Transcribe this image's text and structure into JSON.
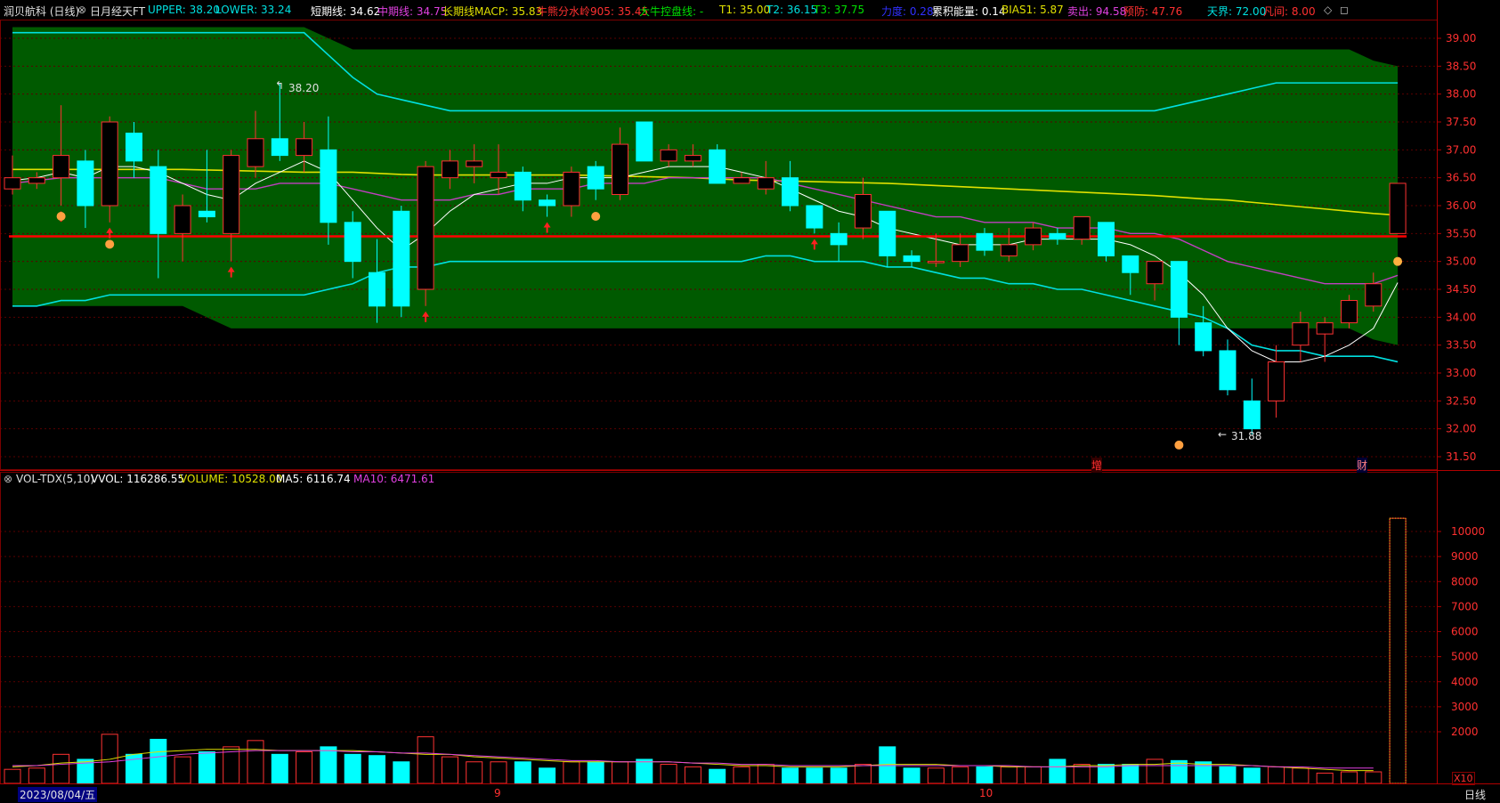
{
  "header": {
    "stock": "润贝航科 (日线)",
    "indicator": "日月经天FT",
    "upper": "UPPER: 38.20",
    "lower": "LOWER: 33.24",
    "short_line": "短期线: 34.62",
    "mid_line": "中期线: 34.75",
    "long_line": "长期线MACP: 35.83",
    "bull_line": "牛熊分水岭905: 35.45",
    "big_bull": "大牛控盘线: -",
    "t1": "T1: 35.00",
    "t2": "T2: 36.15",
    "t3": "T3: 37.75",
    "force": "力度: 0.28",
    "energy": "累积能量: 0.14",
    "bias": "BIAS1: 5.87",
    "sell": "卖出: 94.58",
    "warn": "预防: 47.76",
    "sky": "天界: 72.00",
    "hell": "凡间: 8.00"
  },
  "volume_header": {
    "name": "VOL-TDX(5,10)",
    "vvol": "VVOL: 116286.55",
    "volume": "VOLUME: 10528.00",
    "ma5": "MA5: 6116.74",
    "ma10": "MA10: 6471.61"
  },
  "annotations": {
    "high_label": "38.20",
    "low_label": "31.88",
    "zeng": "增",
    "cai": "财"
  },
  "footer": {
    "date": "2023/08/04/五",
    "month_9": "9",
    "month_10": "10",
    "period": "日线",
    "x10": "X10"
  },
  "colors": {
    "up": "#ff3232",
    "down": "#00ffff",
    "band_fill": "#005a00",
    "ma_short": "#ffffff",
    "ma_mid": "#c040c0",
    "ma_long": "#e0e000",
    "bull_line": "#ff0000",
    "band_line": "#00e0e0"
  },
  "chart_data": [
    {
      "type": "candlestick",
      "title": "润贝航科 (日线)",
      "ylim": [
        31.3,
        39.3
      ],
      "yticks": [
        31.5,
        32.0,
        32.5,
        33.0,
        33.5,
        34.0,
        34.5,
        35.0,
        35.5,
        36.0,
        36.5,
        37.0,
        37.5,
        38.0,
        38.5,
        39.0
      ],
      "candles": [
        {
          "o": 36.3,
          "c": 36.5,
          "h": 36.9,
          "l": 36.2
        },
        {
          "o": 36.4,
          "c": 36.5,
          "h": 36.6,
          "l": 36.3
        },
        {
          "o": 36.5,
          "c": 36.9,
          "h": 37.8,
          "l": 36.0
        },
        {
          "o": 36.8,
          "c": 36.0,
          "h": 37.0,
          "l": 35.6
        },
        {
          "o": 36.0,
          "c": 37.5,
          "h": 37.6,
          "l": 35.7
        },
        {
          "o": 37.3,
          "c": 36.8,
          "h": 37.5,
          "l": 36.5
        },
        {
          "o": 36.7,
          "c": 35.5,
          "h": 37.0,
          "l": 34.7
        },
        {
          "o": 35.5,
          "c": 36.0,
          "h": 36.2,
          "l": 35.0
        },
        {
          "o": 35.9,
          "c": 35.8,
          "h": 37.0,
          "l": 35.7
        },
        {
          "o": 35.5,
          "c": 36.9,
          "h": 37.0,
          "l": 35.0
        },
        {
          "o": 36.7,
          "c": 37.2,
          "h": 37.7,
          "l": 36.5
        },
        {
          "o": 37.2,
          "c": 36.9,
          "h": 38.2,
          "l": 36.8
        },
        {
          "o": 36.9,
          "c": 37.2,
          "h": 37.5,
          "l": 36.6
        },
        {
          "o": 37.0,
          "c": 35.7,
          "h": 37.6,
          "l": 35.3
        },
        {
          "o": 35.7,
          "c": 35.0,
          "h": 35.9,
          "l": 34.7
        },
        {
          "o": 34.8,
          "c": 34.2,
          "h": 35.4,
          "l": 33.9
        },
        {
          "o": 35.9,
          "c": 34.2,
          "h": 36.0,
          "l": 34.0
        },
        {
          "o": 34.5,
          "c": 36.7,
          "h": 36.8,
          "l": 34.2
        },
        {
          "o": 36.5,
          "c": 36.8,
          "h": 37.0,
          "l": 36.3
        },
        {
          "o": 36.7,
          "c": 36.8,
          "h": 37.1,
          "l": 36.4
        },
        {
          "o": 36.5,
          "c": 36.6,
          "h": 37.1,
          "l": 36.2
        },
        {
          "o": 36.6,
          "c": 36.1,
          "h": 36.7,
          "l": 35.9
        },
        {
          "o": 36.1,
          "c": 36.0,
          "h": 36.2,
          "l": 35.8
        },
        {
          "o": 36.0,
          "c": 36.6,
          "h": 36.7,
          "l": 35.8
        },
        {
          "o": 36.7,
          "c": 36.3,
          "h": 36.8,
          "l": 36.1
        },
        {
          "o": 36.2,
          "c": 37.1,
          "h": 37.4,
          "l": 36.1
        },
        {
          "o": 37.5,
          "c": 36.8,
          "h": 37.5,
          "l": 36.8
        },
        {
          "o": 36.8,
          "c": 37.0,
          "h": 37.1,
          "l": 36.7
        },
        {
          "o": 36.8,
          "c": 36.9,
          "h": 37.1,
          "l": 36.7
        },
        {
          "o": 37.0,
          "c": 36.4,
          "h": 37.1,
          "l": 36.4
        },
        {
          "o": 36.4,
          "c": 36.5,
          "h": 36.6,
          "l": 36.4
        },
        {
          "o": 36.3,
          "c": 36.5,
          "h": 36.8,
          "l": 36.2
        },
        {
          "o": 36.5,
          "c": 36.0,
          "h": 36.8,
          "l": 35.9
        },
        {
          "o": 36.0,
          "c": 35.6,
          "h": 36.0,
          "l": 35.5
        },
        {
          "o": 35.5,
          "c": 35.3,
          "h": 35.7,
          "l": 35.0
        },
        {
          "o": 35.6,
          "c": 36.2,
          "h": 36.5,
          "l": 35.4
        },
        {
          "o": 35.9,
          "c": 35.1,
          "h": 35.9,
          "l": 34.9
        },
        {
          "o": 35.1,
          "c": 35.0,
          "h": 35.2,
          "l": 34.9
        },
        {
          "o": 35.0,
          "c": 35.0,
          "h": 35.5,
          "l": 34.9
        },
        {
          "o": 35.0,
          "c": 35.3,
          "h": 35.5,
          "l": 34.9
        },
        {
          "o": 35.5,
          "c": 35.2,
          "h": 35.6,
          "l": 35.1
        },
        {
          "o": 35.1,
          "c": 35.3,
          "h": 35.6,
          "l": 35.0
        },
        {
          "o": 35.3,
          "c": 35.6,
          "h": 35.7,
          "l": 35.2
        },
        {
          "o": 35.5,
          "c": 35.4,
          "h": 35.6,
          "l": 35.3
        },
        {
          "o": 35.4,
          "c": 35.8,
          "h": 35.8,
          "l": 35.3
        },
        {
          "o": 35.7,
          "c": 35.1,
          "h": 35.7,
          "l": 35.0
        },
        {
          "o": 35.1,
          "c": 34.8,
          "h": 35.1,
          "l": 34.4
        },
        {
          "o": 34.6,
          "c": 35.0,
          "h": 35.0,
          "l": 34.3
        },
        {
          "o": 35.0,
          "c": 34.0,
          "h": 35.0,
          "l": 33.5
        },
        {
          "o": 33.9,
          "c": 33.4,
          "h": 34.2,
          "l": 33.3
        },
        {
          "o": 33.4,
          "c": 32.7,
          "h": 33.6,
          "l": 32.6
        },
        {
          "o": 32.5,
          "c": 32.0,
          "h": 32.9,
          "l": 31.9
        },
        {
          "o": 32.5,
          "c": 33.2,
          "h": 33.5,
          "l": 32.2
        },
        {
          "o": 33.5,
          "c": 33.9,
          "h": 34.1,
          "l": 33.2
        },
        {
          "o": 33.7,
          "c": 33.9,
          "h": 34.0,
          "l": 33.2
        },
        {
          "o": 33.9,
          "c": 34.3,
          "h": 34.4,
          "l": 33.8
        },
        {
          "o": 34.2,
          "c": 34.6,
          "h": 34.8,
          "l": 34.1
        },
        {
          "o": 35.5,
          "c": 36.4,
          "h": 36.4,
          "l": 35.5
        }
      ],
      "band": {
        "upper": [
          39.2,
          39.2,
          39.2,
          39.2,
          39.2,
          39.2,
          39.2,
          39.2,
          39.2,
          39.2,
          39.2,
          39.2,
          39.2,
          39.0,
          38.8,
          38.8,
          38.8,
          38.8,
          38.8,
          38.8,
          38.8,
          38.8,
          38.8,
          38.8,
          38.8,
          38.8,
          38.8,
          38.8,
          38.8,
          38.8,
          38.8,
          38.8,
          38.8,
          38.8,
          38.8,
          38.8,
          38.8,
          38.8,
          38.8,
          38.8,
          38.8,
          38.8,
          38.8,
          38.8,
          38.8,
          38.8,
          38.8,
          38.8,
          38.8,
          38.8,
          38.8,
          38.8,
          38.8,
          38.8,
          38.8,
          38.8,
          38.6,
          38.5
        ],
        "lower": [
          34.2,
          34.2,
          34.2,
          34.2,
          34.2,
          34.2,
          34.2,
          34.2,
          34.0,
          33.8,
          33.8,
          33.8,
          33.8,
          33.8,
          33.8,
          33.8,
          33.8,
          33.8,
          33.8,
          33.8,
          33.8,
          33.8,
          33.8,
          33.8,
          33.8,
          33.8,
          33.8,
          33.8,
          33.8,
          33.8,
          33.8,
          33.8,
          33.8,
          33.8,
          33.8,
          33.8,
          33.8,
          33.8,
          33.8,
          33.8,
          33.8,
          33.8,
          33.8,
          33.8,
          33.8,
          33.8,
          33.8,
          33.8,
          33.8,
          33.8,
          33.8,
          33.8,
          33.8,
          33.8,
          33.8,
          33.8,
          33.6,
          33.5
        ],
        "upper_line": [
          39.1,
          39.1,
          39.1,
          39.1,
          39.1,
          39.1,
          39.1,
          39.1,
          39.1,
          39.1,
          39.1,
          39.1,
          39.1,
          38.7,
          38.3,
          38.0,
          37.9,
          37.8,
          37.7,
          37.7,
          37.7,
          37.7,
          37.7,
          37.7,
          37.7,
          37.7,
          37.7,
          37.7,
          37.7,
          37.7,
          37.7,
          37.7,
          37.7,
          37.7,
          37.7,
          37.7,
          37.7,
          37.7,
          37.7,
          37.7,
          37.7,
          37.7,
          37.7,
          37.7,
          37.7,
          37.7,
          37.7,
          37.7,
          37.8,
          37.9,
          38.0,
          38.1,
          38.2,
          38.2,
          38.2,
          38.2,
          38.2,
          38.2
        ],
        "lower_line": [
          34.2,
          34.2,
          34.3,
          34.3,
          34.4,
          34.4,
          34.4,
          34.4,
          34.4,
          34.4,
          34.4,
          34.4,
          34.4,
          34.5,
          34.6,
          34.8,
          34.9,
          34.9,
          35.0,
          35.0,
          35.0,
          35.0,
          35.0,
          35.0,
          35.0,
          35.0,
          35.0,
          35.0,
          35.0,
          35.0,
          35.0,
          35.1,
          35.1,
          35.0,
          35.0,
          35.0,
          34.9,
          34.9,
          34.8,
          34.7,
          34.7,
          34.6,
          34.6,
          34.5,
          34.5,
          34.4,
          34.3,
          34.2,
          34.1,
          34.0,
          33.8,
          33.5,
          33.4,
          33.4,
          33.3,
          33.3,
          33.3,
          33.2
        ]
      },
      "ma_short": [
        36.45,
        36.5,
        36.6,
        36.5,
        36.7,
        36.7,
        36.6,
        36.4,
        36.2,
        36.1,
        36.4,
        36.6,
        36.8,
        36.6,
        36.1,
        35.6,
        35.2,
        35.5,
        35.9,
        36.2,
        36.3,
        36.4,
        36.4,
        36.5,
        36.5,
        36.5,
        36.6,
        36.7,
        36.7,
        36.7,
        36.6,
        36.5,
        36.3,
        36.1,
        35.9,
        35.8,
        35.6,
        35.5,
        35.4,
        35.3,
        35.3,
        35.3,
        35.4,
        35.4,
        35.4,
        35.4,
        35.3,
        35.1,
        34.8,
        34.4,
        33.8,
        33.4,
        33.2,
        33.2,
        33.3,
        33.5,
        33.8,
        34.62
      ],
      "ma_mid": [
        36.4,
        36.45,
        36.5,
        36.5,
        36.5,
        36.5,
        36.5,
        36.4,
        36.3,
        36.3,
        36.3,
        36.4,
        36.4,
        36.4,
        36.3,
        36.2,
        36.1,
        36.1,
        36.1,
        36.2,
        36.2,
        36.3,
        36.3,
        36.3,
        36.4,
        36.4,
        36.4,
        36.5,
        36.5,
        36.5,
        36.5,
        36.5,
        36.4,
        36.3,
        36.2,
        36.1,
        36.0,
        35.9,
        35.8,
        35.8,
        35.7,
        35.7,
        35.7,
        35.6,
        35.6,
        35.6,
        35.5,
        35.5,
        35.4,
        35.2,
        35.0,
        34.9,
        34.8,
        34.7,
        34.6,
        34.6,
        34.6,
        34.75
      ],
      "ma_long": [
        36.65,
        36.65,
        36.65,
        36.65,
        36.65,
        36.65,
        36.65,
        36.65,
        36.64,
        36.63,
        36.62,
        36.61,
        36.6,
        36.6,
        36.6,
        36.58,
        36.56,
        36.55,
        36.55,
        36.55,
        36.55,
        36.55,
        36.55,
        36.55,
        36.54,
        36.53,
        36.52,
        36.51,
        36.5,
        36.48,
        36.46,
        36.45,
        36.44,
        36.43,
        36.42,
        36.41,
        36.4,
        36.38,
        36.36,
        36.34,
        36.32,
        36.3,
        36.28,
        36.26,
        36.24,
        36.22,
        36.2,
        36.18,
        36.15,
        36.12,
        36.1,
        36.06,
        36.02,
        35.98,
        35.94,
        35.9,
        35.86,
        35.83
      ],
      "bull_line": 35.45
    },
    {
      "type": "bar",
      "title": "VOL-TDX(5,10)",
      "ylim": [
        0,
        11000
      ],
      "yticks": [
        2000,
        3000,
        4000,
        5000,
        6000,
        7000,
        8000,
        9000,
        10000
      ],
      "values": [
        500,
        550,
        1100,
        900,
        1900,
        1100,
        1700,
        1000,
        1200,
        1400,
        1650,
        1100,
        1200,
        1400,
        1100,
        1050,
        800,
        1800,
        1000,
        800,
        800,
        800,
        550,
        800,
        800,
        800,
        900,
        700,
        600,
        500,
        600,
        700,
        550,
        550,
        550,
        700,
        1400,
        550,
        550,
        600,
        600,
        600,
        600,
        900,
        700,
        700,
        700,
        900,
        850,
        800,
        600,
        550,
        600,
        550,
        350,
        400,
        400,
        10528
      ],
      "ma5": [
        600,
        650,
        750,
        800,
        900,
        1100,
        1200,
        1250,
        1300,
        1300,
        1300,
        1250,
        1250,
        1250,
        1250,
        1200,
        1150,
        1100,
        1100,
        1000,
        950,
        900,
        850,
        800,
        800,
        800,
        800,
        800,
        750,
        700,
        650,
        650,
        600,
        600,
        600,
        650,
        700,
        700,
        700,
        650,
        650,
        600,
        600,
        600,
        650,
        650,
        700,
        700,
        750,
        700,
        700,
        650,
        600,
        550,
        500,
        450,
        450,
        6116.74
      ],
      "ma10": [
        650,
        650,
        700,
        750,
        800,
        900,
        1000,
        1100,
        1150,
        1200,
        1250,
        1250,
        1250,
        1250,
        1200,
        1200,
        1150,
        1150,
        1100,
        1050,
        1000,
        950,
        900,
        850,
        850,
        800,
        800,
        800,
        750,
        750,
        700,
        700,
        650,
        650,
        650,
        650,
        650,
        650,
        650,
        650,
        650,
        650,
        600,
        600,
        600,
        600,
        650,
        650,
        650,
        650,
        650,
        650,
        600,
        600,
        550,
        550,
        550,
        6471.61
      ]
    }
  ]
}
